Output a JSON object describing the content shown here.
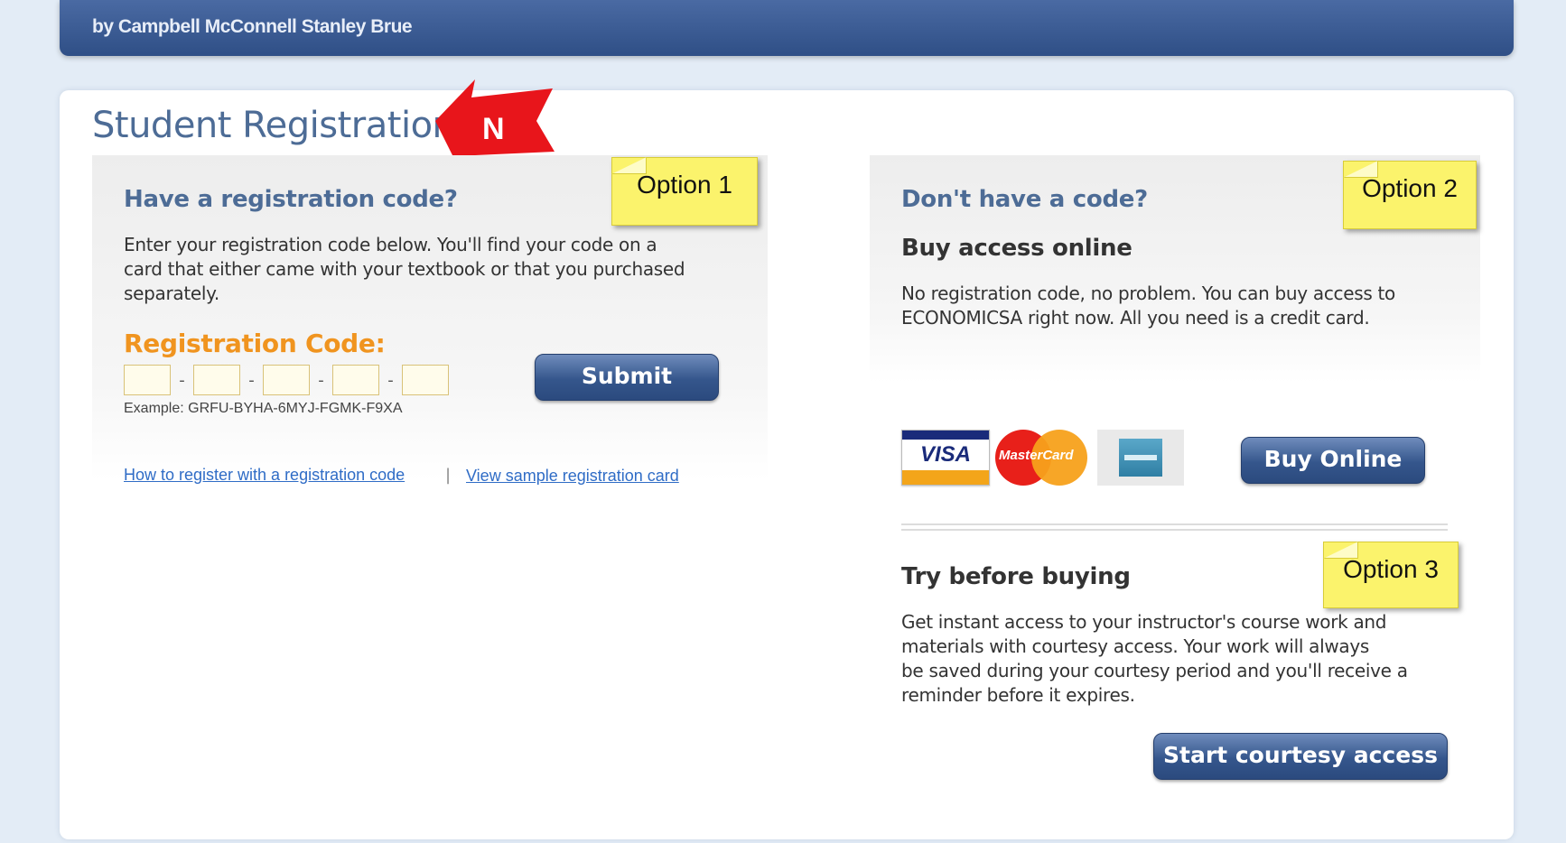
{
  "header": {
    "authors": "by Campbell McConnell Stanley Brue"
  },
  "page": {
    "title": "Student Registration"
  },
  "annotation": {
    "arrow_letter": "N"
  },
  "option1": {
    "note": "Option 1",
    "heading": "Have a registration code?",
    "description_lines": [
      "Enter your registration code below. You'll find your code on a",
      "card that either came with your textbook or that you purchased",
      "separately."
    ],
    "code_label": "Registration Code:",
    "example": "Example: GRFU-BYHA-6MYJ-FGMK-F9XA",
    "submit_label": "Submit",
    "link_how": "How to register with a registration code",
    "link_separator": "|",
    "link_sample": "View sample registration card"
  },
  "option2": {
    "note": "Option 2",
    "heading": "Don't have a code?",
    "subheading": "Buy access online",
    "description_lines": [
      "No registration code, no problem. You can buy access to",
      "ECONOMICSA right now. All you need is a credit card."
    ],
    "cards": {
      "visa": "VISA",
      "mastercard": "MasterCard"
    },
    "buy_label": "Buy Online"
  },
  "option3": {
    "note": "Option 3",
    "heading": "Try before buying",
    "description_lines": [
      "Get instant access to your instructor's course work and",
      "materials with courtesy access. Your work will always",
      "be saved during your courtesy period and you'll receive a",
      "reminder before it expires."
    ],
    "start_label": "Start courtesy access"
  },
  "colors": {
    "brand_blue": "#4d6c96",
    "button_blue": "#35568c",
    "accent_orange": "#f0941f",
    "note_yellow": "#fbf36c",
    "arrow_red": "#e8151b"
  }
}
